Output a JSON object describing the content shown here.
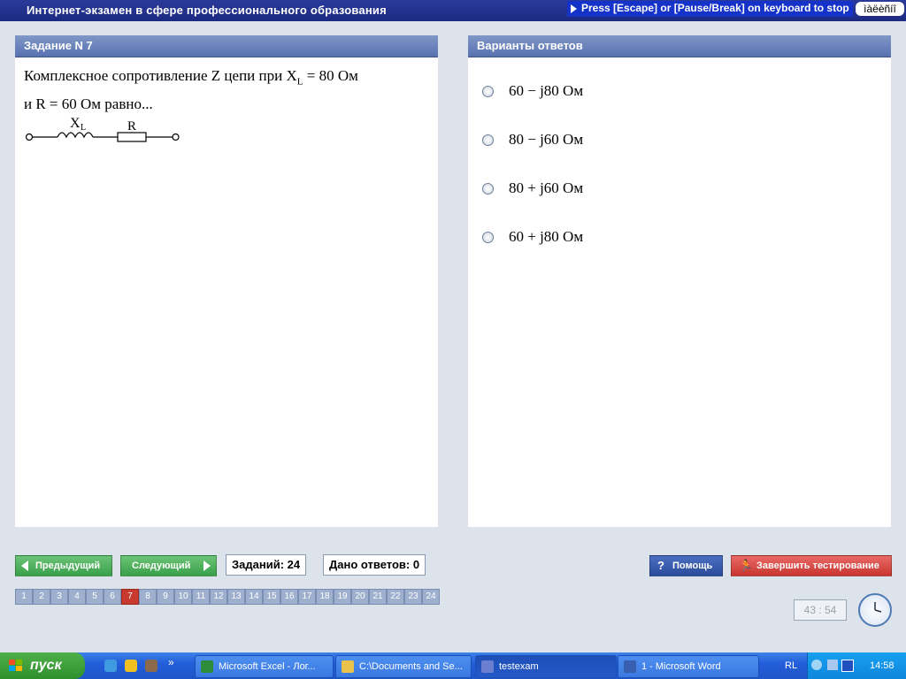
{
  "window": {
    "title": "Интернет-экзамен в сфере профессионального образования",
    "stop_hint": "Press [Escape] or [Pause/Break] on keyboard to stop",
    "keyboard_layout": "ìàëèñíî"
  },
  "question": {
    "header": "Задание N 7",
    "text_line1": "Комплексное сопротивление Z цепи при X",
    "text_line1_sub": "L",
    "text_line1_tail": " = 80  Ом",
    "text_line2": "и R = 60  Ом равно...",
    "circuit": {
      "inductor_label": "X",
      "inductor_sub": "L",
      "resistor_label": "R"
    }
  },
  "answers": {
    "header": "Варианты ответов",
    "options": [
      {
        "label": "60 − j80  Ом"
      },
      {
        "label": "80 − j60  Ом"
      },
      {
        "label": "80 + j60  Ом"
      },
      {
        "label": "60 + j80  Ом"
      }
    ]
  },
  "controls": {
    "prev_label": "Предыдущий",
    "next_label": "Следующий",
    "tasks_count": "Заданий: 24",
    "answered_count": "Дано ответов: 0",
    "help_label": "Помощь",
    "finish_label": "Завершить тестирование"
  },
  "pager": {
    "pages": [
      "1",
      "2",
      "3",
      "4",
      "5",
      "6",
      "7",
      "8",
      "9",
      "10",
      "11",
      "12",
      "13",
      "14",
      "15",
      "16",
      "17",
      "18",
      "19",
      "20",
      "21",
      "22",
      "23",
      "24"
    ],
    "current": "7"
  },
  "timer": "43 : 54",
  "taskbar": {
    "start_label": "пуск",
    "tasks": [
      {
        "label": "Microsoft Excel - Лог...",
        "icon": "excel-icon",
        "color": "#2e8b3a"
      },
      {
        "label": "C:\\Documents and Se...",
        "icon": "folder-icon",
        "color": "#e8c24a"
      },
      {
        "label": "testexam",
        "icon": "app-icon",
        "color": "#6a7fd0"
      },
      {
        "label": "1 - Microsoft Word",
        "icon": "word-icon",
        "color": "#3a5fb0"
      }
    ],
    "lang": "RL",
    "time": "14:58"
  }
}
